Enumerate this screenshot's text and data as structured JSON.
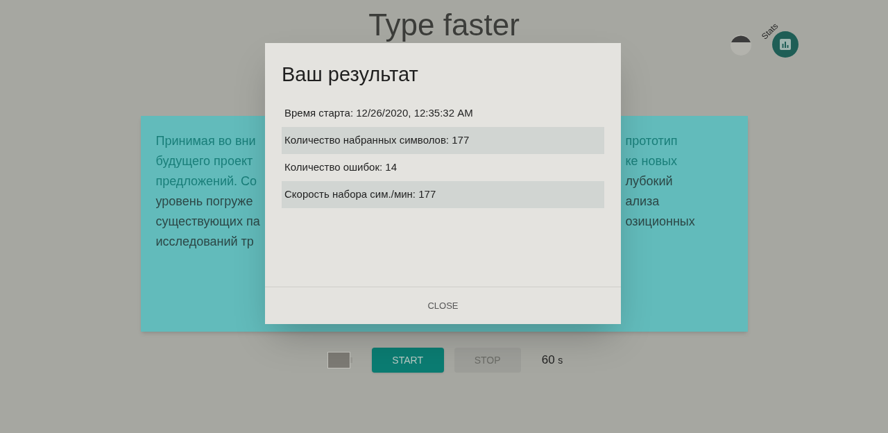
{
  "page": {
    "title": "Type faster",
    "stats_label": "Stats"
  },
  "text_lines": [
    {
      "left": {
        "text": "Принимая во вни",
        "typed": true
      },
      "right": {
        "text": "прототип",
        "typed": true
      }
    },
    {
      "left": {
        "text": "будущего проект",
        "typed": true
      },
      "right": {
        "text": "ке новых",
        "typed": true
      }
    },
    {
      "left": {
        "text": "предложений. Со",
        "typed": true
      },
      "right": {
        "text": "лубокий",
        "typed": false
      }
    },
    {
      "left": {
        "text": "уровень погруже",
        "typed": false
      },
      "right": {
        "text": "ализа",
        "typed": false
      }
    },
    {
      "left": {
        "text": "существующих па",
        "typed": false
      },
      "right": {
        "text": "озиционных",
        "typed": false
      }
    },
    {
      "left": {
        "text": "исследований тр",
        "typed": false
      }
    }
  ],
  "controls": {
    "start": {
      "label": "START",
      "disabled": false
    },
    "stop": {
      "label": "STOP",
      "disabled": true
    },
    "timer": {
      "value": "60",
      "unit": "s"
    }
  },
  "dialog": {
    "title": "Ваш результат",
    "rows": [
      {
        "text": "Время старта: 12/26/2020, 12:35:32 AM",
        "shaded": false
      },
      {
        "text": "Количество набранных символов: 177",
        "shaded": true
      },
      {
        "text": "Количество ошибок: 14",
        "shaded": false
      },
      {
        "text": "Скорость набора сим./мин: 177",
        "shaded": true
      }
    ],
    "close": "CLOSE"
  }
}
